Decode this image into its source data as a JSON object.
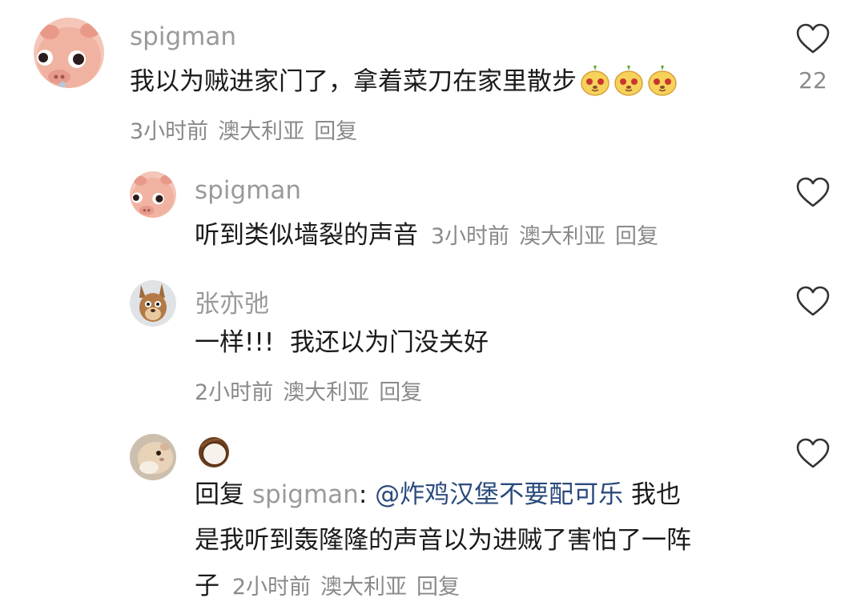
{
  "comments": [
    {
      "username": "spigman",
      "text": "我以为贼进家门了，拿着菜刀在家里散步",
      "time": "3小时前",
      "location": "澳大利亚",
      "reply_label": "回复",
      "likes": "22",
      "avatar": "pig-avatar"
    },
    {
      "username": "spigman",
      "text": "听到类似墙裂的声音",
      "time": "3小时前",
      "location": "澳大利亚",
      "reply_label": "回复",
      "avatar": "pig-avatar"
    },
    {
      "username": "张亦弛",
      "text": "一样!!!  我还以为门没关好",
      "time": "2小时前",
      "location": "澳大利亚",
      "reply_label": "回复",
      "avatar": "kangaroo-avatar"
    },
    {
      "username_icon": "coconut-icon",
      "reply_prefix": "回复",
      "reply_to": "spigman",
      "reply_colon": ":",
      "mention": "@炸鸡汉堡不要配可乐",
      "text_line1": "我也",
      "text_line2": "是我听到轰隆隆的声音以为进贼了害怕了一阵",
      "text_line3": "子",
      "time": "2小时前",
      "location": "澳大利亚",
      "reply_label": "回复",
      "avatar": "hamster-avatar"
    }
  ],
  "colors": {
    "username": "#9a9a9a",
    "meta": "#8a8a8a",
    "mention": "#2a4a7c",
    "text": "#1a1a1a"
  }
}
